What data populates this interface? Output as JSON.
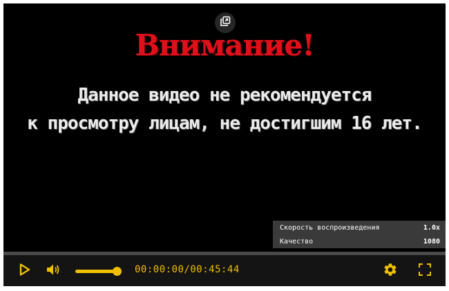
{
  "warning": {
    "title": "Внимание!",
    "line1": "Данное видео не рекомендуется",
    "line2": "к просмотру лицам, не достигшим 16 лет."
  },
  "settings_menu": {
    "items": [
      {
        "label": "Скорость воспроизведения",
        "value": "1.0x"
      },
      {
        "label": "Качество",
        "value": "1080"
      }
    ]
  },
  "controls": {
    "time": "00:00:00/00:45:44",
    "progress_fraction": 0,
    "volume_fraction": 1.0,
    "icons": {
      "pip": "picture-in-picture-icon",
      "play": "play-icon",
      "volume": "speaker-icon",
      "settings": "gear-icon",
      "fullscreen": "fullscreen-icon"
    }
  },
  "colors": {
    "accent": "#f0c000",
    "title_red": "#e0101a",
    "background": "#000000"
  }
}
